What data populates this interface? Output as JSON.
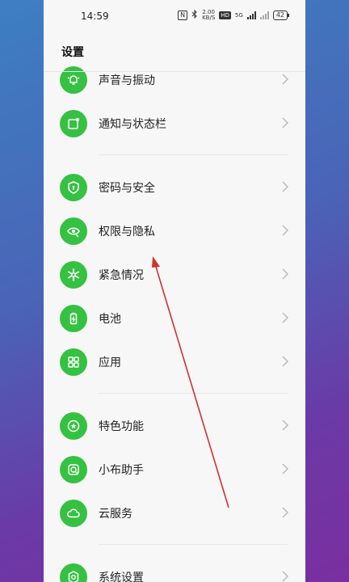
{
  "status_bar": {
    "time": "14:59",
    "net_speed_top": "2.00",
    "net_speed_bottom": "KB/S",
    "nfc_label": "N",
    "hd_label": "HD",
    "mobile_label": "5G",
    "battery": "42"
  },
  "header": {
    "title": "设置"
  },
  "items": [
    {
      "label": "声音与振动",
      "icon": "bell-icon"
    },
    {
      "label": "通知与状态栏",
      "icon": "notification-icon"
    },
    {
      "label": "密码与安全",
      "icon": "shield-icon"
    },
    {
      "label": "权限与隐私",
      "icon": "eye-privacy-icon"
    },
    {
      "label": "紧急情况",
      "icon": "asterisk-icon"
    },
    {
      "label": "电池",
      "icon": "battery-icon"
    },
    {
      "label": "应用",
      "icon": "apps-grid-icon"
    },
    {
      "label": "特色功能",
      "icon": "star-icon"
    },
    {
      "label": "小布助手",
      "icon": "assistant-icon"
    },
    {
      "label": "云服务",
      "icon": "cloud-icon"
    },
    {
      "label": "系统设置",
      "icon": "gear-icon"
    }
  ],
  "colors": {
    "icon_green": "#35c141",
    "annotation_red": "#d0312d"
  }
}
